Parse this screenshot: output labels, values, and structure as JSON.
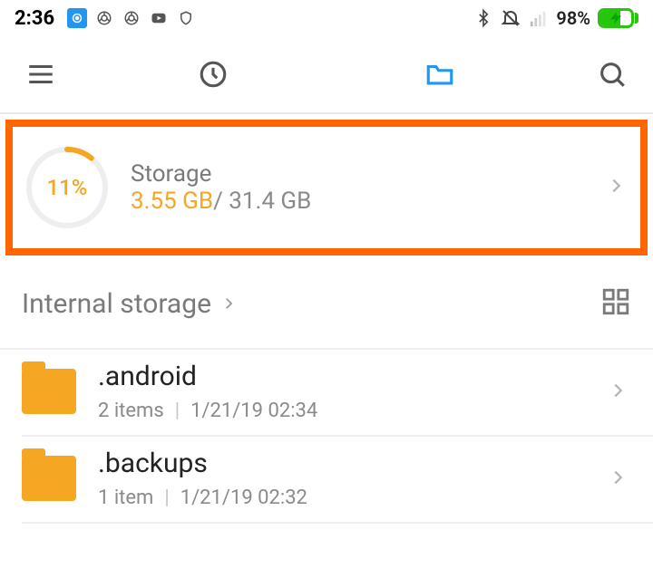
{
  "statusbar": {
    "time": "2:36",
    "battery_pct": "98%"
  },
  "storage_card": {
    "percent_label": "11%",
    "percent_value": 11,
    "title": "Storage",
    "used": "3.55 GB",
    "total": "/ 31.4 GB"
  },
  "breadcrumb": {
    "path": "Internal storage"
  },
  "rows": [
    {
      "name": ".android",
      "count": "2 items",
      "date": "1/21/19 02:34"
    },
    {
      "name": ".backups",
      "count": "1 item",
      "date": "1/21/19 02:32"
    }
  ]
}
